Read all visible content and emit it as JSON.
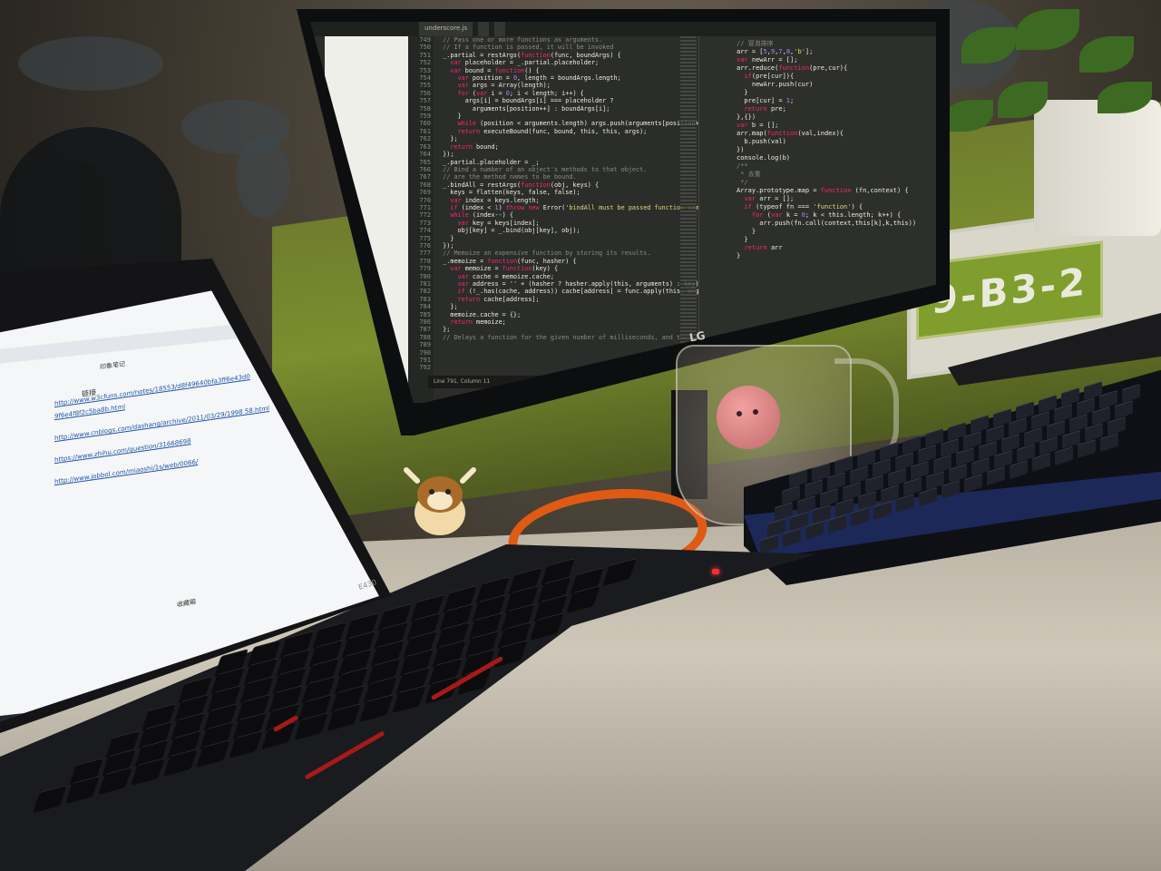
{
  "scene": {
    "sign_text": "9-B3-2",
    "monitor_brand": "LG",
    "laptop_model": "E430"
  },
  "monitor": {
    "tabs": [
      "underscore.js",
      "",
      ""
    ],
    "line_numbers": [
      "749",
      "750",
      "751",
      "752",
      "753",
      "754",
      "755",
      "756",
      "757",
      "758",
      "759",
      "760",
      "761",
      "762",
      "763",
      "764",
      "765",
      "766",
      "767",
      "768",
      "769",
      "770",
      "771",
      "772",
      "773",
      "774",
      "775",
      "776",
      "777",
      "778",
      "779",
      "780",
      "781",
      "782",
      "783",
      "784",
      "785",
      "786",
      "787",
      "788",
      "789",
      "790",
      "791",
      "792"
    ],
    "code_lines": [
      "  // Pass one or more functions as arguments.",
      "  // If a function is passed, it will be invoked",
      "  _.partial = restArgs(function(func, boundArgs) {",
      "    var placeholder = _.partial.placeholder;",
      "    var bound = function() {",
      "      var position = 0, length = boundArgs.length;",
      "      var args = Array(length);",
      "      for (var i = 0; i < length; i++) {",
      "        args[i] = boundArgs[i] === placeholder ?",
      "          arguments[position++] : boundArgs[i];",
      "      }",
      "      while (position < arguments.length) args.push(arguments[position++]);",
      "      return executeBound(func, bound, this, this, args);",
      "    };",
      "    return bound;",
      "  });",
      "",
      "  _.partial.placeholder = _;",
      "",
      "  // Bind a number of an object's methods to that object.",
      "  // are the method names to be bound.",
      "  _.bindAll = restArgs(function(obj, keys) {",
      "    keys = flatten(keys, false, false);",
      "    var index = keys.length;",
      "    if (index < 1) throw new Error('bindAll must be passed function names');",
      "    while (index--) {",
      "      var key = keys[index];",
      "      obj[key] = _.bind(obj[key], obj);",
      "    }",
      "  });",
      "",
      "  // Memoize an expensive function by storing its results.",
      "  _.memoize = function(func, hasher) {",
      "    var memoize = function(key) {",
      "      var cache = memoize.cache;",
      "      var address = '' + (hasher ? hasher.apply(this, arguments) : key);",
      "      if (!_.has(cache, address)) cache[address] = func.apply(this, arguments);",
      "      return cache[address];",
      "    };",
      "    memoize.cache = {};",
      "    return memoize;",
      "  };",
      "",
      "  // Delays a function for the given number of milliseconds, and then calls"
    ],
    "side_code_lines": [
      "// 冒泡排序",
      "arr = [5,9,7,8,'b'];",
      "",
      "var newArr = [];",
      "arr.reduce(function(pre,cur){",
      "  if(pre[cur]){",
      "    newArr.push(cur)",
      "  }",
      "  pre[cur] = 1;",
      "  return pre;",
      "},{})",
      "",
      "var b = [];",
      "arr.map(function(val,index){",
      "  b.push(val)",
      "})",
      "console.log(b)",
      "",
      "/**",
      " * 去重",
      " */",
      "Array.prototype.map = function (fn,context) {",
      "  var arr = [];",
      "  if (typeof fn === 'function') {",
      "    for (var k = 0; k < this.length; k++) {",
      "      arr.push(fn.call(context,this[k],k,this))",
      "    }",
      "  }",
      "  return arr",
      "}"
    ],
    "status_text": "Line 791, Column 11"
  },
  "laptop": {
    "note_title": "印象笔记",
    "heading": "链接",
    "links": [
      "http://www.w3cfuns.com/notes/18553/d8f49640bfa3ff6e43d0 9f6e4f8f2c5ba8b.html",
      "http://www.cnblogs.com/dashang/archive/2011/03/29/1998 58.html",
      "https://www.zhihu.com/question/31668698",
      "http://www.jobbol.com/miaoshi/1s/web/0066/"
    ],
    "footer_label": "收藏箱"
  },
  "colors": {
    "partition_green": "#7c8e2e",
    "keyboard_blue": "#1e2d63",
    "lanyard_orange": "#e05a14",
    "editor_bg": "#2b2d2a",
    "keyword_pink": "#f92672",
    "string_yellow": "#e6db74"
  }
}
